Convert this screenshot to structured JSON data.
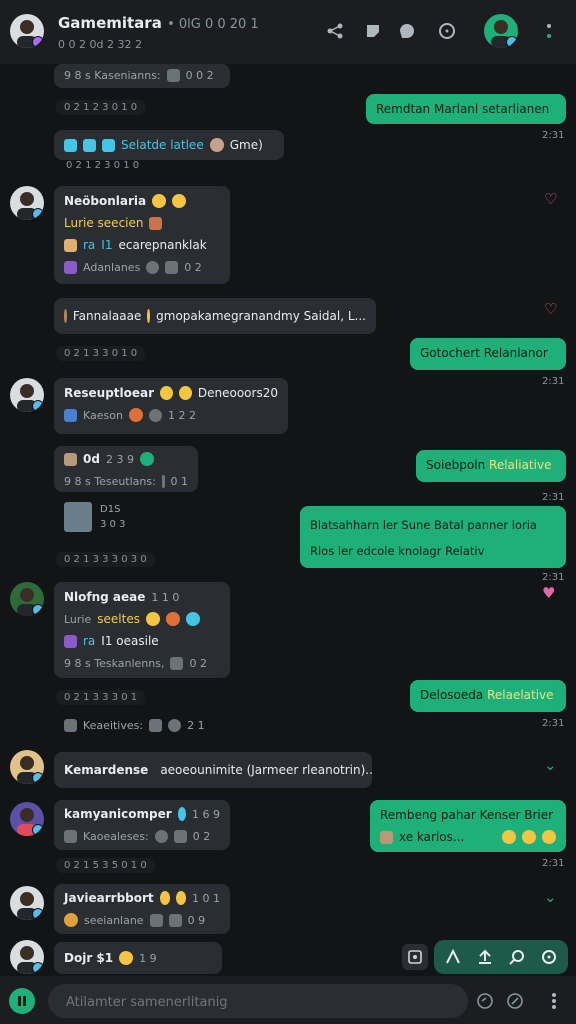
{
  "header": {
    "title": "Gamemitara",
    "title_extra": "• 0lG 0 0 20 1",
    "subtitle": "0 0 2 0d 2 32 2",
    "icons": [
      "share-icon",
      "sticker-icon",
      "reaction-icon",
      "timer-icon",
      "profile-avatar",
      "more-icon"
    ]
  },
  "messages": {
    "m1_text": "9 8 s Kasenianns:",
    "m1_meta": "0 0 2",
    "sep1": "0 2 1 2 3 0 1 0",
    "s1_text": "Remdtan Marlanl setarlianen",
    "s1_time": "2:31",
    "m2_text": "Selatde  latlee",
    "m2_extra": "Gme)",
    "m2_time": "0 2 1 2 3 0 1 0",
    "m3_name": "Neöbonlaria",
    "m3_line1": "Lurie  seecien",
    "m3_line2a": "ra",
    "m3_line2b": "I1",
    "m3_line2c": "ecarepnanklak",
    "m3_line3": "Adanlanes",
    "m3_meta": "0 2",
    "m4_text": "Fannalaaae",
    "m4_rest": "gmopakamegranandmy Saidal, L...",
    "sep2": "0 2 1 3 3 0 1 0",
    "s2_text": "Gotochert Relanlanor",
    "s2_time": "2:31",
    "m5_name": "Reseuptloear",
    "m5_extra": "Deneooors20",
    "m5_extra2": "1 1 1 1 1 1",
    "m5_line2": "Kaeson",
    "m5_meta": "1 2 2",
    "m6_name": "0d",
    "m6_num": "2 3 9",
    "m6_line2": "9 8 s Teseutlans:",
    "m6_meta": "0 1",
    "s3_text_a": "Soiebpoln",
    "s3_text_b": "Relaliative",
    "s3_time": "2:31",
    "m7_line1": "D1S",
    "m7_line2": "3 0 3",
    "s4_line1": "Blatsahharn ler Sune Batal panner loria",
    "s4_line2": "Rlos ler edcole knolagr Relativ",
    "s4_time": "2:31",
    "sep3": "0 2 1 3 3 3 0 3 0",
    "m8_name": "Nlofng aeae",
    "m8_num": "1 1 0",
    "m8_line1a": "Lurie",
    "m8_line1b": "seeltes",
    "m8_line2a": "ra",
    "m8_line2b": "I1 oeasile",
    "m8_line3": "9 8 s Teskanlenns,",
    "m8_meta": "0 2",
    "sep4": "0 2 1 3 3 3 0 1",
    "s5_text_a": "Delosoeda",
    "s5_text_b": "Relaelative",
    "s5_time": "2:31",
    "m9_text": "Keaeitives:",
    "m9_meta": "2 1",
    "m10_name": "Kemardense",
    "m10_rest": "aeoeounimite (Jarmeer rleanotrin)...",
    "m11_name": "kamyanicomper",
    "m11_num": "1 6 9",
    "m11_line2": "Kaoealeses:",
    "m11_meta": "0 2",
    "s6_line1": "Rembeng pahar Kenser Brier",
    "s6_line2": "xe karlos...",
    "s6_time": "2:31",
    "sep5": "0 2 1 5 3 5 0 1 0",
    "m12_name": "Javiearrbbort",
    "m12_num": "1 0 1",
    "m12_line2": "seeianlane",
    "m12_meta": "0 9",
    "m13_name": "Dojr $1",
    "m13_num": "1 9"
  },
  "composer": {
    "placeholder": "Atilamter samenerlitanig"
  },
  "colors": {
    "accent": "#1fb07a",
    "background": "#121416",
    "received": "#2a2d32"
  }
}
